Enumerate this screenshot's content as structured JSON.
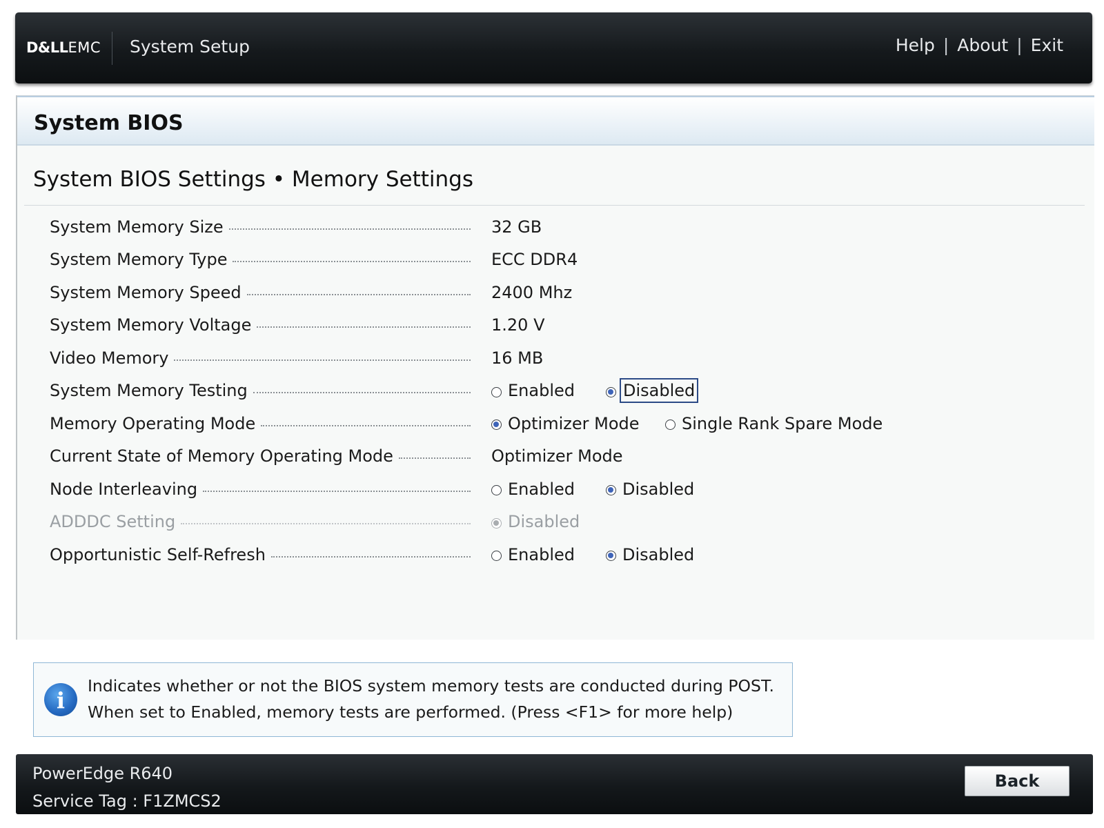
{
  "header": {
    "logo_part1": "D&LL",
    "logo_part2": "EMC",
    "title": "System Setup",
    "links": {
      "help": "Help",
      "about": "About",
      "exit": "Exit",
      "separator": "|"
    }
  },
  "panel": {
    "title": "System BIOS",
    "section": "System BIOS Settings • Memory Settings"
  },
  "settings": [
    {
      "label": "System Memory Size",
      "value": "32 GB"
    },
    {
      "label": "System Memory Type",
      "value": "ECC DDR4"
    },
    {
      "label": "System Memory Speed",
      "value": "2400 Mhz"
    },
    {
      "label": "System Memory Voltage",
      "value": "1.20 V"
    },
    {
      "label": "Video Memory",
      "value": "16 MB"
    },
    {
      "label": "System Memory Testing",
      "options": [
        "Enabled",
        "Disabled"
      ],
      "selected": "Disabled"
    },
    {
      "label": "Memory Operating Mode",
      "options": [
        "Optimizer Mode",
        "Single Rank Spare Mode"
      ],
      "selected": "Optimizer Mode"
    },
    {
      "label": "Current State of Memory Operating Mode",
      "value": "Optimizer Mode"
    },
    {
      "label": "Node Interleaving",
      "options": [
        "Enabled",
        "Disabled"
      ],
      "selected": "Disabled"
    },
    {
      "label": "ADDDC Setting",
      "options": [
        "Disabled"
      ],
      "selected": "Disabled",
      "disabled": true
    },
    {
      "label": "Opportunistic Self-Refresh",
      "options": [
        "Enabled",
        "Disabled"
      ],
      "selected": "Disabled"
    }
  ],
  "help": {
    "icon": "info-icon",
    "icon_glyph": "i",
    "line1": "Indicates whether or not the BIOS system memory tests are conducted during POST.",
    "line2": "When set to Enabled, memory tests are performed. (Press <F1> for more help)"
  },
  "footer": {
    "model": "PowerEdge R640",
    "service_tag": "Service Tag : F1ZMCS2",
    "back_label": "Back"
  },
  "colors": {
    "header_bg": "#15191c",
    "panel_bg": "#f7f9f8",
    "radio_selected": "#3e64b8",
    "help_border": "#8fb7d6",
    "info_icon": "#2468c0"
  }
}
